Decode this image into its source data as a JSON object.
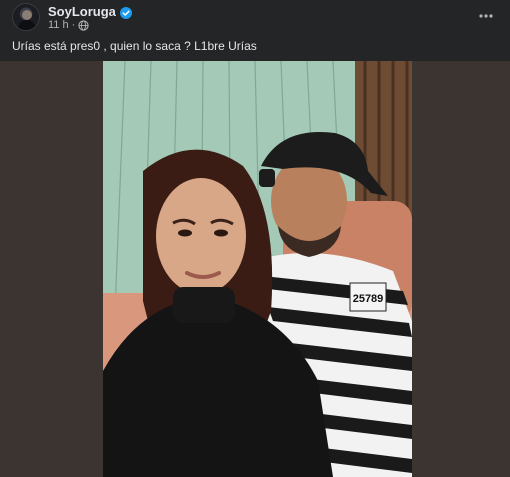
{
  "post": {
    "author": "SoyLoruga",
    "timestamp": "11 h",
    "separator": "·",
    "caption": "Urías está pres0 , quien lo saca ? L1bre Urías"
  },
  "icons": {
    "verified": "verified-badge-icon",
    "audience": "globe-icon",
    "more": "more-options-icon"
  },
  "photo": {
    "badge_number": "25789"
  },
  "colors": {
    "background": "#242526",
    "text_primary": "#e4e6eb",
    "text_secondary": "#b0b3b8",
    "verified_blue": "#1d9bf0",
    "media_frame": "#3b3430"
  }
}
